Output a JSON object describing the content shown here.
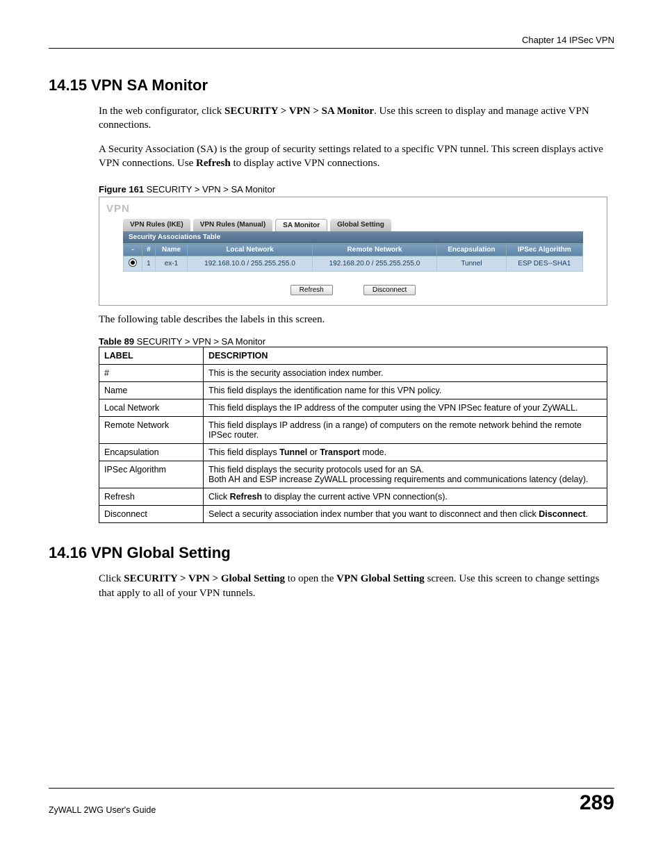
{
  "header": {
    "chapter": "Chapter 14 IPSec VPN"
  },
  "section1": {
    "title": "14.15  VPN SA Monitor",
    "p1_a": "In the web configurator, click ",
    "p1_b": "SECURITY > VPN > SA Monitor",
    "p1_c": ". Use this screen to display and manage active VPN connections.",
    "p2_a": "A Security Association (SA) is the group of security settings related to a specific VPN tunnel. This screen displays active VPN connections. Use ",
    "p2_b": "Refresh",
    "p2_c": " to display active VPN connections.",
    "figcap_a": "Figure 161",
    "figcap_b": "   SECURITY > VPN > SA Monitor",
    "after_fig": "The following table describes the labels in this screen.",
    "tablecap_a": "Table 89",
    "tablecap_b": "   SECURITY > VPN > SA Monitor"
  },
  "screenshot": {
    "title": "VPN",
    "tabs": {
      "ike": "VPN Rules (IKE)",
      "manual": "VPN Rules (Manual)",
      "sa": "SA Monitor",
      "global": "Global Setting"
    },
    "panel_title": "Security Associations Table",
    "cols": {
      "blank": "-",
      "num": "#",
      "name": "Name",
      "local": "Local Network",
      "remote": "Remote Network",
      "encap": "Encapsulation",
      "algo": "IPSec Algorithm"
    },
    "row": {
      "num": "1",
      "name": "ex-1",
      "local": "192.168.10.0 / 255.255.255.0",
      "remote": "192.168.20.0 / 255.255.255.0",
      "encap": "Tunnel",
      "algo": "ESP DES--SHA1"
    },
    "buttons": {
      "refresh": "Refresh",
      "disconnect": "Disconnect"
    }
  },
  "desc_table": {
    "h_label": "LABEL",
    "h_desc": "DESCRIPTION",
    "rows": [
      {
        "label": "#",
        "desc": "This is the security association index number."
      },
      {
        "label": "Name",
        "desc": "This field displays the identification name for this VPN policy."
      },
      {
        "label": "Local Network",
        "desc": "This field displays the IP address of the computer using the VPN IPSec feature of your ZyWALL."
      },
      {
        "label": "Remote Network",
        "desc": "This field displays IP address (in a range) of computers on the remote network behind the remote IPSec router."
      },
      {
        "label": "Encapsulation",
        "desc_a": "This field displays ",
        "desc_b": "Tunnel",
        "desc_c": " or ",
        "desc_d": "Transport",
        "desc_e": " mode."
      },
      {
        "label": "IPSec Algorithm",
        "desc": "This field displays the security protocols used for an SA.\nBoth AH and ESP increase ZyWALL processing requirements and communications latency (delay)."
      },
      {
        "label": "Refresh",
        "desc_a": "Click ",
        "desc_b": "Refresh",
        "desc_c": " to display the current active VPN connection(s)."
      },
      {
        "label": "Disconnect",
        "desc_a": "Select a security association index number that you want to disconnect and then click ",
        "desc_b": "Disconnect",
        "desc_c": "."
      }
    ]
  },
  "section2": {
    "title": "14.16  VPN Global Setting",
    "p1_a": "Click ",
    "p1_b": "SECURITY > VPN > Global Setting",
    "p1_c": " to open the ",
    "p1_d": "VPN Global Setting",
    "p1_e": " screen. Use this screen to change settings that apply to all of your VPN tunnels."
  },
  "footer": {
    "guide": "ZyWALL 2WG User's Guide",
    "page": "289"
  }
}
